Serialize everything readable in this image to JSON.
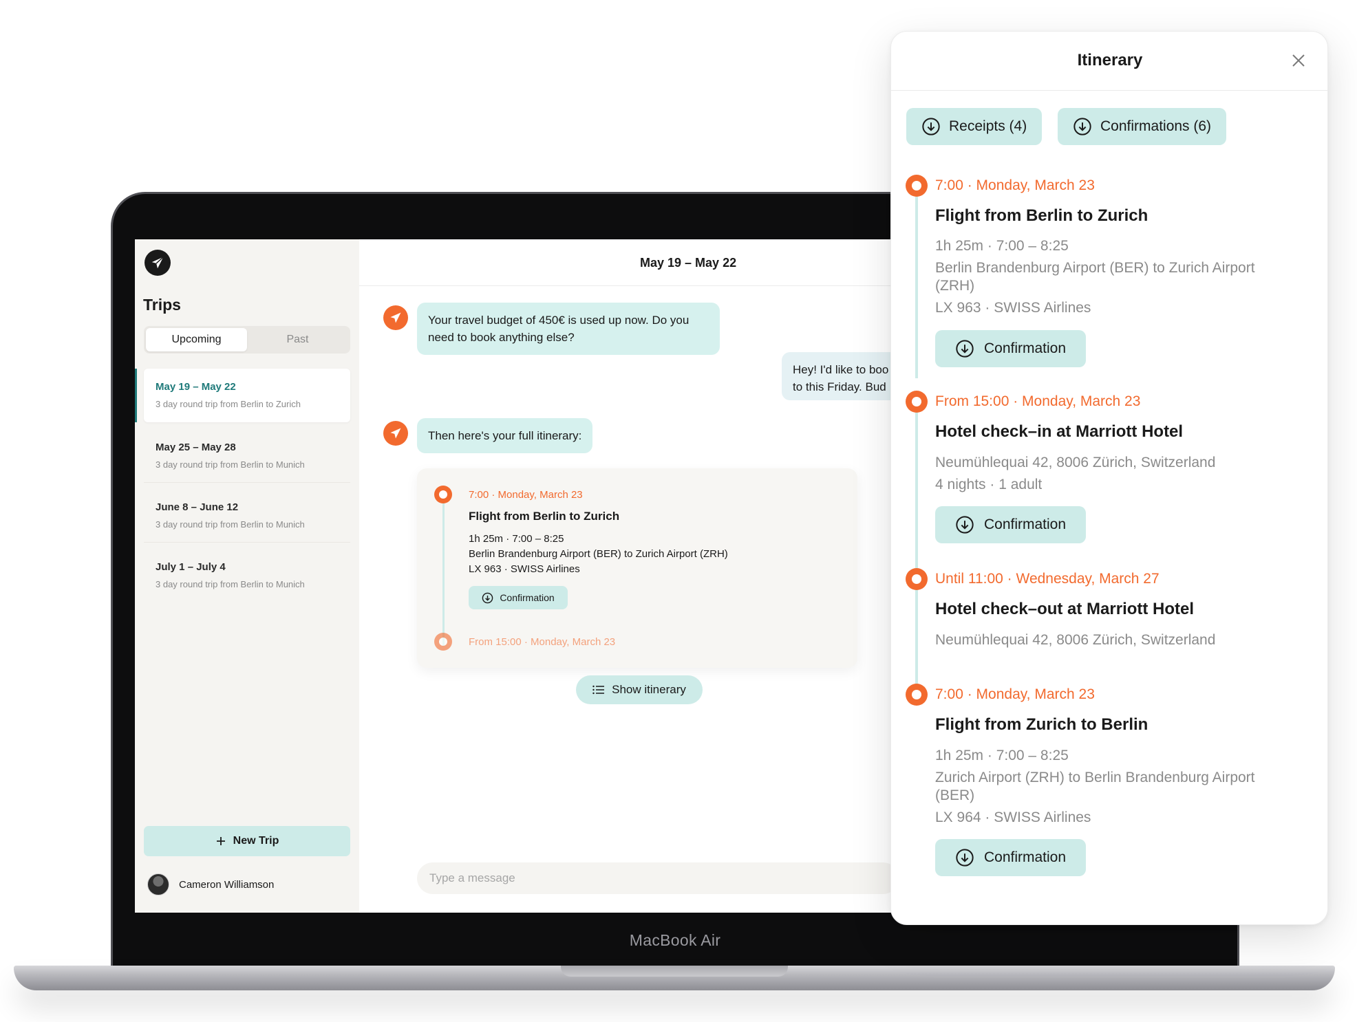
{
  "device": {
    "brand_label": "MacBook Air"
  },
  "sidebar": {
    "logo_icon": "paper-plane-icon",
    "title": "Trips",
    "tabs": [
      {
        "label": "Upcoming",
        "active": true
      },
      {
        "label": "Past",
        "active": false
      }
    ],
    "trips": [
      {
        "dates": "May 19 – May 22",
        "description": "3 day round trip from Berlin to Zurich"
      },
      {
        "dates": "May 25 – May 28",
        "description": "3 day round trip from Berlin to Munich"
      },
      {
        "dates": "June 8 – June 12",
        "description": "3 day round trip from Berlin to Munich"
      },
      {
        "dates": "July 1 – July 4",
        "description": "3 day round trip from Berlin to Munich"
      }
    ],
    "new_trip_label": "New Trip",
    "user_name": "Cameron Williamson"
  },
  "chat": {
    "title": "May 19 – May 22",
    "messages": [
      {
        "from": "bot",
        "text": "Your travel budget of 450€ is used up now. Do you need to book anything else?"
      },
      {
        "from": "user",
        "text": "Hey! I'd like to boo… to this Friday. Bud…"
      },
      {
        "from": "bot",
        "text": "Then here's your full itinerary:"
      }
    ],
    "user_lines": [
      "Hey! I'd like to boo",
      "to this Friday. Bud"
    ],
    "itinerary_card": {
      "time": "7:00 · Monday, March 23",
      "title": "Flight from Berlin to Zurich",
      "duration": "1h 25m · 7:00 – 8:25",
      "route": "Berlin Brandenburg Airport (BER) to Zurich Airport (ZRH)",
      "flight": "LX 963 · SWISS Airlines",
      "confirmation_label": "Confirmation",
      "next_time": "From 15:00 · Monday, March 23"
    },
    "show_itinerary_label": "Show itinerary",
    "input_placeholder": "Type a message"
  },
  "panel": {
    "title": "Itinerary",
    "receipts_label": "Receipts (4)",
    "confirmations_label": "Confirmations (6)",
    "events": [
      {
        "time": "7:00 · Monday, March 23",
        "title": "Flight from Berlin to Zurich",
        "details": [
          "1h 25m · 7:00 – 8:25",
          "Berlin Brandenburg Airport (BER) to Zurich Airport (ZRH)",
          "LX 963 · SWISS Airlines"
        ],
        "button": "Confirmation"
      },
      {
        "time": "From 15:00 · Monday, March 23",
        "title": "Hotel check–in at Marriott Hotel",
        "details": [
          "Neumühlequai 42, 8006 Zürich, Switzerland",
          "4 nights · 1 adult"
        ],
        "button": "Confirmation"
      },
      {
        "time": "Until 11:00 · Wednesday, March 27",
        "title": "Hotel check–out at Marriott Hotel",
        "details": [
          "Neumühlequai 42, 8006 Zürich, Switzerland"
        ]
      },
      {
        "time": "7:00 · Monday, March 23",
        "title": "Flight from Zurich to Berlin",
        "details": [
          "1h 25m · 7:00 – 8:25",
          "Zurich Airport (ZRH) to Berlin Brandenburg Airport (BER)",
          "LX 964 · SWISS Airlines"
        ],
        "button": "Confirmation"
      }
    ]
  },
  "colors": {
    "accent_orange": "#f26a2e",
    "mint": "#cdebe8",
    "teal_text": "#1f7a7a",
    "sidebar_bg": "#f5f4f1"
  }
}
